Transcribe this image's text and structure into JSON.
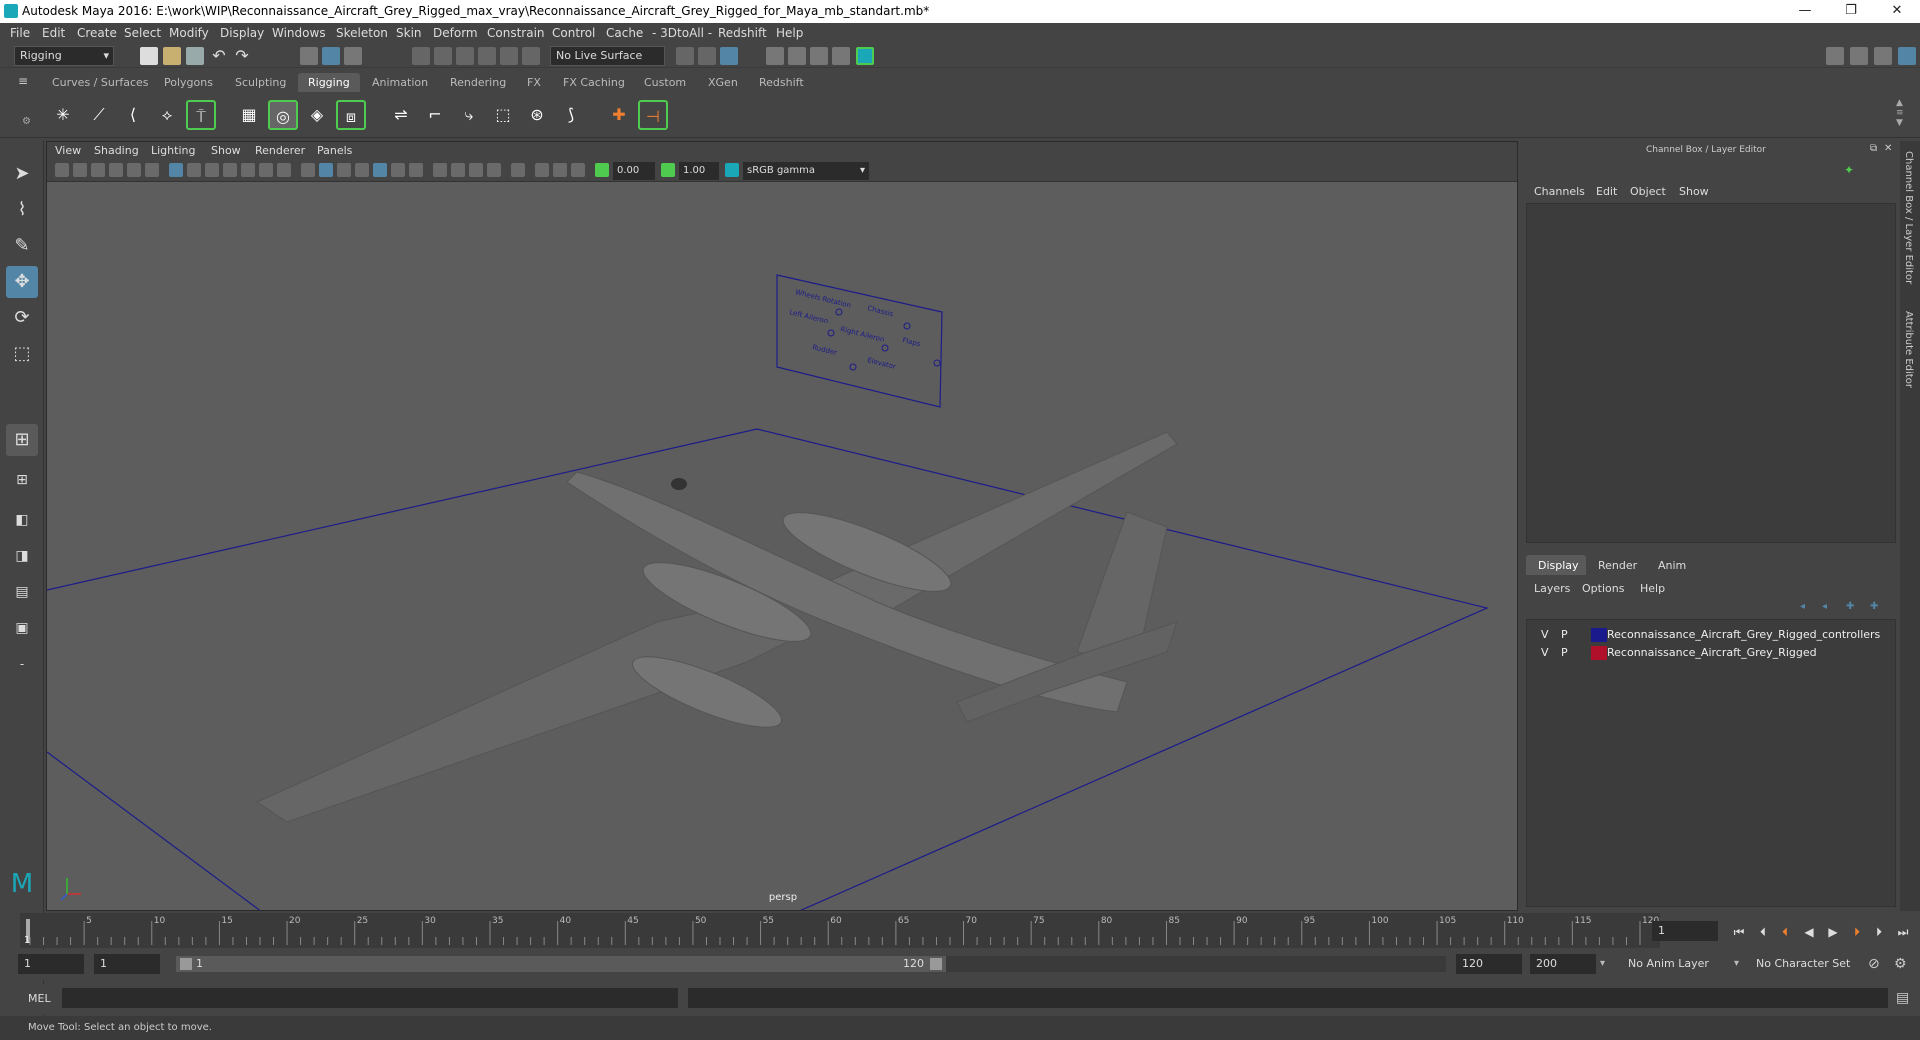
{
  "window": {
    "title": "Autodesk Maya 2016: E:\\work\\WIP\\Reconnaissance_Aircraft_Grey_Rigged_max_vray\\Reconnaissance_Aircraft_Grey_Rigged_for_Maya_mb_standart.mb*",
    "minimize": "—",
    "restore": "❐",
    "close": "✕"
  },
  "menus": [
    "File",
    "Edit",
    "Create",
    "Select",
    "Modify",
    "Display",
    "Windows",
    "Skeleton",
    "Skin",
    "Deform",
    "Constrain",
    "Control",
    "Cache",
    "- 3DtoAll -",
    "Redshift",
    "Help"
  ],
  "status": {
    "menuset": "Rigging",
    "live_surface": "No Live Surface"
  },
  "shelf_tabs": [
    "Curves / Surfaces",
    "Polygons",
    "Sculpting",
    "Rigging",
    "Animation",
    "Rendering",
    "FX",
    "FX Caching",
    "Custom",
    "XGen",
    "Redshift"
  ],
  "shelf_active": "Rigging",
  "viewport": {
    "menus": [
      "View",
      "Shading",
      "Lighting",
      "Show",
      "Renderer",
      "Panels"
    ],
    "exposure": "0.00",
    "gamma": "1.00",
    "colorspace": "sRGB gamma",
    "camera_label": "persp",
    "controls_board": {
      "labels": [
        "Wheels Rotation",
        "Chassis",
        "Left Aileron",
        "Right Aileron",
        "Flaps",
        "Rudder",
        "Elevator"
      ]
    }
  },
  "channel_box": {
    "title": "Channel Box / Layer Editor",
    "menus": [
      "Channels",
      "Edit",
      "Object",
      "Show"
    ]
  },
  "layer_editor": {
    "tabs": [
      "Display",
      "Render",
      "Anim"
    ],
    "active_tab": "Display",
    "menus": [
      "Layers",
      "Options",
      "Help"
    ],
    "layers": [
      {
        "v": "V",
        "p": "P",
        "name": "Reconnaissance_Aircraft_Grey_Rigged_controllers",
        "color": "#1a1a8c"
      },
      {
        "v": "V",
        "p": "P",
        "name": "Reconnaissance_Aircraft_Grey_Rigged",
        "color": "#b0102a"
      }
    ]
  },
  "side_tabs": [
    "Channel Box / Layer Editor",
    "Attribute Editor"
  ],
  "timeline": {
    "ticks": [
      "5",
      "10",
      "15",
      "20",
      "25",
      "30",
      "35",
      "40",
      "45",
      "50",
      "55",
      "60",
      "65",
      "70",
      "75",
      "80",
      "85",
      "90",
      "95",
      "100",
      "105",
      "110",
      "115",
      "120"
    ],
    "start_label": "1",
    "current_frame": "1"
  },
  "range": {
    "start": "1",
    "playback_start": "1",
    "slider_start": "1",
    "slider_end": "120",
    "playback_end": "120",
    "end": "200",
    "anim_layer": "No Anim Layer",
    "character_set": "No Character Set"
  },
  "command": {
    "label": "MEL"
  },
  "help_line": "Move Tool: Select an object to move.",
  "colors": {
    "accent": "#5285a6",
    "shelf_highlight": "#4fcc4f",
    "grid_line": "#1c1c8a",
    "aircraft": "#6e6e6e"
  }
}
